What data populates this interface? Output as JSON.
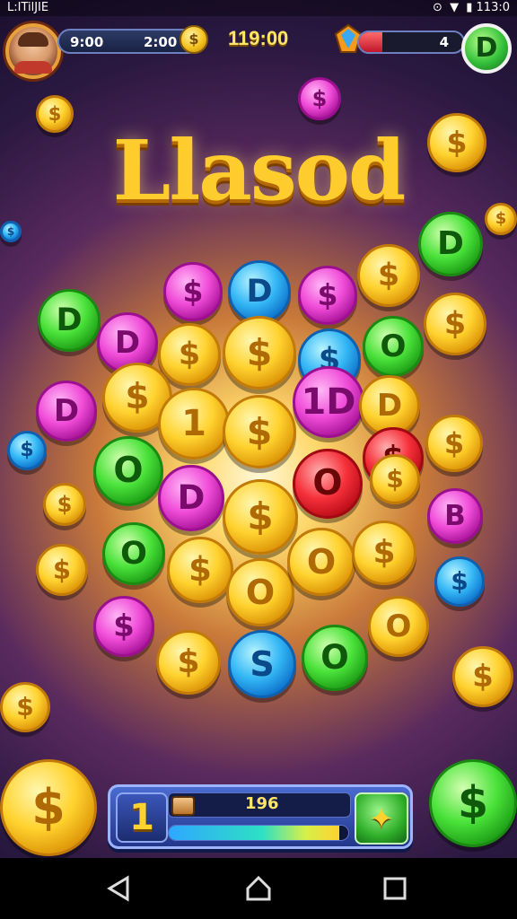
{
  "status_bar": {
    "left_text": "L:ITilJIE",
    "right_text": "113:0"
  },
  "hud_top": {
    "timer_left": "9:00",
    "timer_right": "2:00",
    "coin_badge_glyph": "$",
    "score": "119:00",
    "health_value": "4",
    "health_fraction": 0.22,
    "cash_button_glyph": "D"
  },
  "title": "Llasod",
  "coins": [
    {
      "color": "gold",
      "glyph": "$"
    },
    {
      "color": "pink",
      "glyph": "$"
    },
    {
      "color": "blue",
      "glyph": "D"
    },
    {
      "color": "pink",
      "glyph": "$"
    },
    {
      "color": "gold",
      "glyph": "$"
    },
    {
      "color": "green",
      "glyph": "D"
    },
    {
      "color": "green",
      "glyph": "D"
    },
    {
      "color": "pink",
      "glyph": "D"
    },
    {
      "color": "gold",
      "glyph": "$"
    },
    {
      "color": "gold",
      "glyph": "$"
    },
    {
      "color": "blue",
      "glyph": "$"
    },
    {
      "color": "green",
      "glyph": "O"
    },
    {
      "color": "gold",
      "glyph": "$"
    },
    {
      "color": "pink",
      "glyph": "D"
    },
    {
      "color": "gold",
      "glyph": "$"
    },
    {
      "color": "gold",
      "glyph": "1"
    },
    {
      "color": "gold",
      "glyph": "$"
    },
    {
      "color": "pink",
      "glyph": "1D"
    },
    {
      "color": "gold",
      "glyph": "D"
    },
    {
      "color": "gold",
      "glyph": "$"
    },
    {
      "color": "green",
      "glyph": "O"
    },
    {
      "color": "pink",
      "glyph": "D"
    },
    {
      "color": "gold",
      "glyph": "$"
    },
    {
      "color": "red",
      "glyph": "O"
    },
    {
      "color": "red",
      "glyph": "$"
    },
    {
      "color": "gold",
      "glyph": "$"
    },
    {
      "color": "pink",
      "glyph": "B"
    },
    {
      "color": "gold",
      "glyph": "$"
    },
    {
      "color": "green",
      "glyph": "O"
    },
    {
      "color": "gold",
      "glyph": "$"
    },
    {
      "color": "gold",
      "glyph": "O"
    },
    {
      "color": "gold",
      "glyph": "O"
    },
    {
      "color": "gold",
      "glyph": "$"
    },
    {
      "color": "blue",
      "glyph": "S"
    },
    {
      "color": "pink",
      "glyph": "$"
    },
    {
      "color": "gold",
      "glyph": "$"
    },
    {
      "color": "blue",
      "glyph": "$"
    },
    {
      "color": "green",
      "glyph": "O"
    },
    {
      "color": "gold",
      "glyph": "O"
    },
    {
      "color": "blue",
      "glyph": "$"
    },
    {
      "color": "gold",
      "glyph": "$"
    },
    {
      "color": "pink",
      "glyph": "$"
    },
    {
      "color": "gold",
      "glyph": "$"
    },
    {
      "color": "gold",
      "glyph": "$"
    },
    {
      "color": "gold",
      "glyph": "$"
    },
    {
      "color": "green",
      "glyph": "$"
    },
    {
      "color": "gold",
      "glyph": "$"
    },
    {
      "color": "gold",
      "glyph": "$"
    },
    {
      "color": "blue",
      "glyph": "$"
    }
  ],
  "hud_bottom": {
    "level": "1",
    "count": "196",
    "progress_fraction": 0.95,
    "star_glyph": "✦"
  },
  "navigation": {
    "back": "back-triangle-icon",
    "home": "home-house-icon",
    "recents": "recents-square-icon"
  },
  "colors": {
    "gold": "#ffd22e",
    "pink": "#f04cd8",
    "blue": "#34b7f5",
    "green": "#4ae23a",
    "red": "#f5303a",
    "title": "#ffcc2e"
  }
}
